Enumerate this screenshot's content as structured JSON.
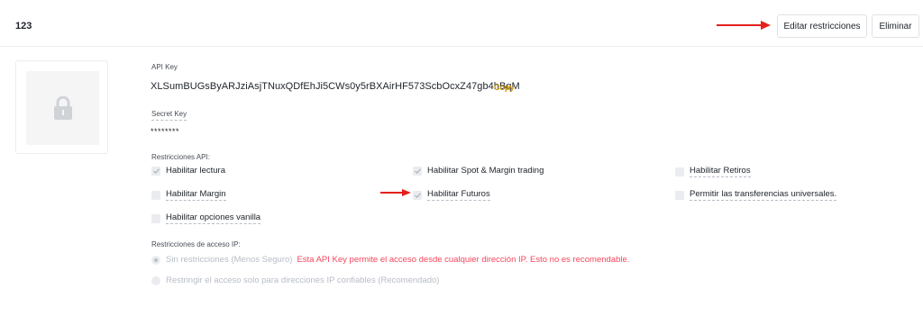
{
  "header": {
    "key_name": "123",
    "edit_label": "Editar restricciones",
    "delete_label": "Eliminar"
  },
  "api_key": {
    "label": "API Key",
    "value": "XLSumBUGsByARJziAsjTNuxQDfEhJi5CWs0y5rBXAirHF573ScbOcxZ47gb4hBqM",
    "copy_label": "Copy"
  },
  "secret_key": {
    "label": "Secret Key",
    "value": "********"
  },
  "restrictions": {
    "label": "Restricciones API:",
    "items": [
      {
        "label": "Habilitar lectura",
        "checked": true
      },
      {
        "label": "Habilitar Spot & Margin trading",
        "checked": true
      },
      {
        "label": "Habilitar Retiros",
        "checked": false
      },
      {
        "label": "Habilitar Margin",
        "checked": false
      },
      {
        "label": "Habilitar Futuros",
        "checked": true
      },
      {
        "label": "Permitir las transferencias universales.",
        "checked": false
      },
      {
        "label": "Habilitar opciones vanilla",
        "checked": false
      }
    ]
  },
  "ip_access": {
    "label": "Restricciones de acceso IP:",
    "unrestricted_label": "Sin restricciones (Menos Seguro)",
    "warning": "Esta API Key permite el acceso desde cualquier dirección IP. Esto no es recomendable.",
    "restricted_label": "Restringir el acceso solo para direcciones IP confiables (Recomendado)"
  },
  "colors": {
    "accent": "#c99400",
    "warning": "#f6465d",
    "arrow": "#e5201b"
  }
}
